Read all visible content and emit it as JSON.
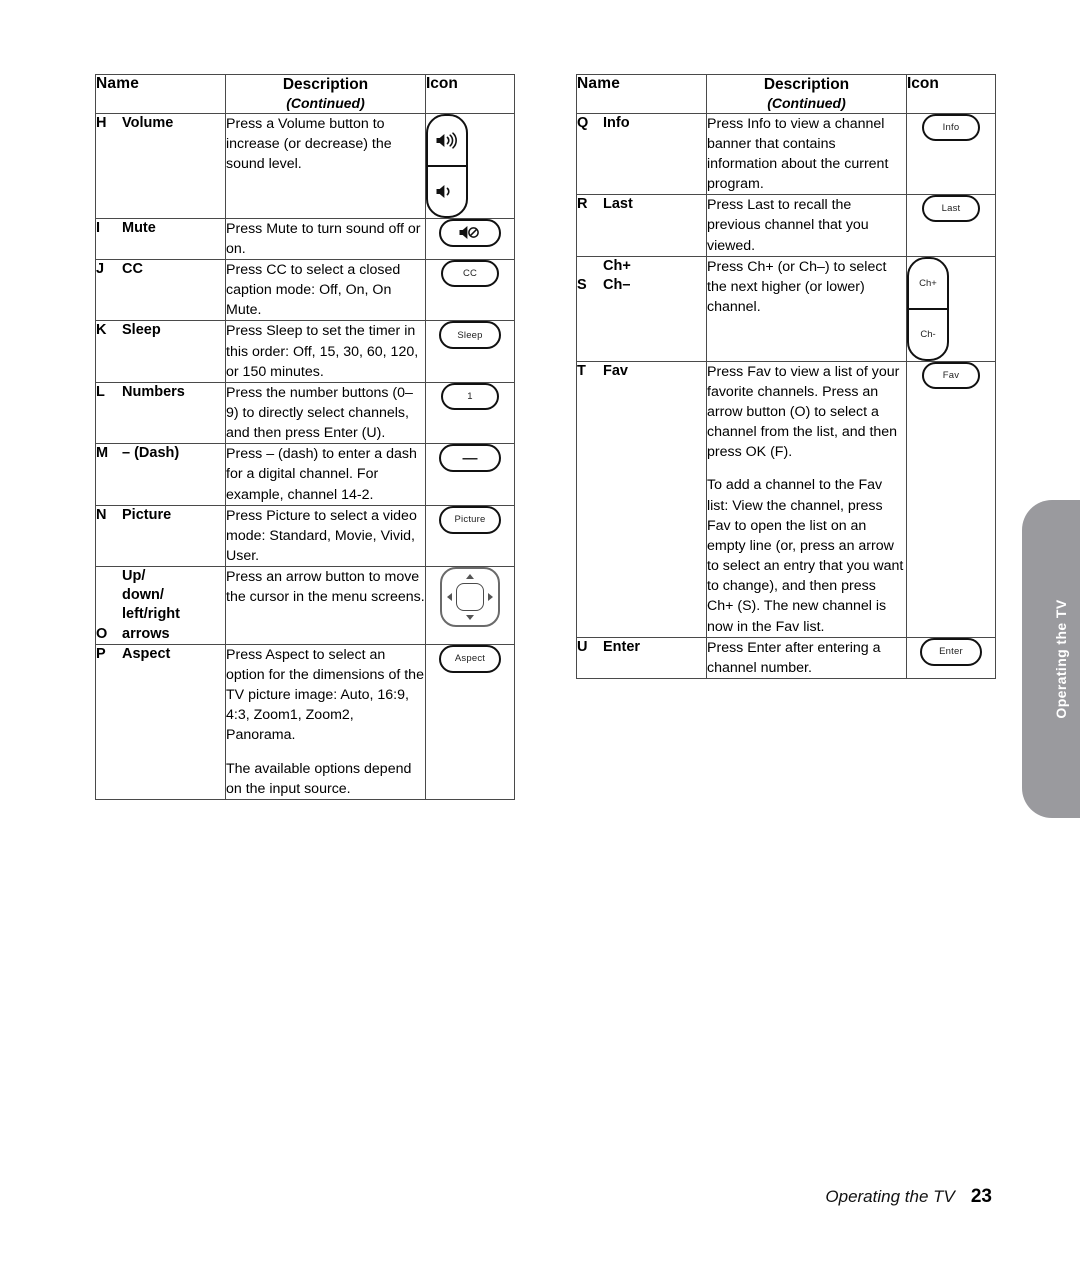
{
  "page": {
    "footer_text": "Operating the TV",
    "footer_page_number": "23",
    "side_tab_label": "Operating the TV",
    "side_tab_color": "#9a9a9e"
  },
  "tables": {
    "left": {
      "headers": {
        "name": "Name",
        "description": "Description",
        "description_sub": "(Continued)",
        "icon": "Icon"
      },
      "rows": [
        {
          "letter": "H",
          "name_lines": [
            "Volume"
          ],
          "paragraphs": [
            "Press a Volume button to increase (or decrease) the sound level."
          ],
          "icon": {
            "kind": "rocker",
            "top_label": "volume-up-icon",
            "bottom_label": "volume-down-icon"
          }
        },
        {
          "letter": "I",
          "name_lines": [
            "Mute"
          ],
          "paragraphs": [
            "Press Mute to turn sound off or on."
          ],
          "icon": {
            "kind": "pill-glyph",
            "label": "mute-speaker-icon"
          }
        },
        {
          "letter": "J",
          "name_lines": [
            "CC"
          ],
          "paragraphs": [
            "Press CC to select a closed caption mode: Off, On, On Mute."
          ],
          "icon": {
            "kind": "pill",
            "label": "CC"
          }
        },
        {
          "letter": "K",
          "name_lines": [
            "Sleep"
          ],
          "paragraphs": [
            "Press Sleep to set the timer in this order: Off, 15, 30, 60, 120, or 150 minutes."
          ],
          "icon": {
            "kind": "pill",
            "label": "Sleep"
          }
        },
        {
          "letter": "L",
          "name_lines": [
            "Numbers"
          ],
          "paragraphs": [
            "Press the number buttons (0–9) to directly select channels, and then press Enter (U)."
          ],
          "icon": {
            "kind": "pill",
            "label": "1"
          }
        },
        {
          "letter": "M",
          "name_lines": [
            "– (Dash)"
          ],
          "paragraphs": [
            "Press – (dash) to enter a dash for a digital channel. For example, channel 14-2."
          ],
          "icon": {
            "kind": "pill-dash",
            "label": "—"
          }
        },
        {
          "letter": "N",
          "name_lines": [
            "Picture"
          ],
          "paragraphs": [
            "Press Picture to select a video mode: Standard, Movie, Vivid, User."
          ],
          "icon": {
            "kind": "pill",
            "label": "Picture"
          }
        },
        {
          "letter": "O",
          "name_lines": [
            "Up/",
            "down/",
            "left/right",
            "arrows"
          ],
          "paragraphs": [
            "Press an arrow button to move the cursor in the menu screens."
          ],
          "icon": {
            "kind": "dpad",
            "label": "arrow-pad-icon"
          }
        },
        {
          "letter": "P",
          "name_lines": [
            "Aspect"
          ],
          "paragraphs": [
            "Press Aspect to select an option for the dimensions of the TV picture image: Auto, 16:9, 4:3, Zoom1, Zoom2, Panorama.",
            "The available options depend on the input source."
          ],
          "icon": {
            "kind": "pill",
            "label": "Aspect"
          }
        }
      ]
    },
    "right": {
      "headers": {
        "name": "Name",
        "description": "Description",
        "description_sub": "(Continued)",
        "icon": "Icon"
      },
      "rows": [
        {
          "letter": "Q",
          "name_lines": [
            "Info"
          ],
          "paragraphs": [
            "Press Info to view a channel banner that contains information about the current program."
          ],
          "icon": {
            "kind": "pill",
            "label": "Info"
          }
        },
        {
          "letter": "R",
          "name_lines": [
            "Last"
          ],
          "paragraphs": [
            "Press Last to recall the previous channel that you viewed."
          ],
          "icon": {
            "kind": "pill",
            "label": "Last"
          }
        },
        {
          "letter": "S",
          "name_lines": [
            "Ch+",
            "Ch–"
          ],
          "paragraphs": [
            "Press Ch+ (or Ch–) to select the next higher (or lower) channel."
          ],
          "icon": {
            "kind": "rocker",
            "top_label": "Ch+",
            "bottom_label": "Ch-"
          }
        },
        {
          "letter": "T",
          "name_lines": [
            "Fav"
          ],
          "paragraphs": [
            "Press Fav to view a list of your favorite channels. Press an arrow button (O) to select a channel from the list, and then press OK (F).",
            "To add a channel to the Fav list: View the channel, press Fav to open the list on an empty line (or, press an arrow to select an entry that you want to change), and then press Ch+ (S). The new channel is now in the Fav list."
          ],
          "icon": {
            "kind": "pill",
            "label": "Fav"
          }
        },
        {
          "letter": "U",
          "name_lines": [
            "Enter"
          ],
          "paragraphs": [
            "Press Enter after entering a channel number."
          ],
          "icon": {
            "kind": "pill",
            "label": "Enter"
          }
        }
      ]
    }
  }
}
